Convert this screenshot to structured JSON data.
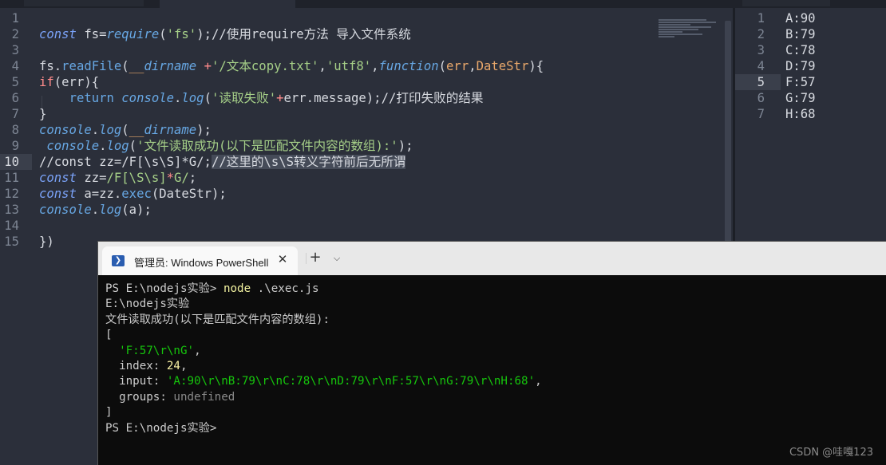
{
  "editor": {
    "lines": [
      {
        "n": "1",
        "segs": []
      },
      {
        "n": "2",
        "segs": [
          [
            "kw",
            "const"
          ],
          [
            "plain",
            " fs="
          ],
          [
            "it",
            "require"
          ],
          [
            "plain",
            "("
          ],
          [
            "str",
            "'fs'"
          ],
          [
            "plain",
            ");//使用require方法 导入文件系统"
          ]
        ]
      },
      {
        "n": "3",
        "segs": []
      },
      {
        "n": "4",
        "segs": [
          [
            "plain",
            "fs."
          ],
          [
            "fn",
            "readFile"
          ],
          [
            "plain",
            "("
          ],
          [
            "param",
            "__"
          ],
          [
            "it",
            "dirname"
          ],
          [
            "plain",
            " "
          ],
          [
            "op",
            "+"
          ],
          [
            "str",
            "'/文本copy.txt'"
          ],
          [
            "plain",
            ","
          ],
          [
            "str",
            "'utf8'"
          ],
          [
            "plain",
            ","
          ],
          [
            "it",
            "function"
          ],
          [
            "plain",
            "("
          ],
          [
            "param",
            "err"
          ],
          [
            "plain",
            ","
          ],
          [
            "param",
            "DateStr"
          ],
          [
            "plain",
            "){"
          ]
        ]
      },
      {
        "n": "5",
        "segs": [
          [
            "op",
            "if"
          ],
          [
            "plain",
            "(err){"
          ]
        ]
      },
      {
        "n": "6",
        "segs": [
          [
            "plain",
            "    "
          ],
          [
            "fn",
            "return"
          ],
          [
            "plain",
            " "
          ],
          [
            "it",
            "console"
          ],
          [
            "plain",
            "."
          ],
          [
            "it",
            "log"
          ],
          [
            "plain",
            "("
          ],
          [
            "str",
            "'读取失败'"
          ],
          [
            "op",
            "+"
          ],
          [
            "plain",
            "err.message);//打印失败的结果"
          ]
        ]
      },
      {
        "n": "7",
        "segs": [
          [
            "plain",
            "}"
          ]
        ]
      },
      {
        "n": "8",
        "segs": [
          [
            "it",
            "console"
          ],
          [
            "plain",
            "."
          ],
          [
            "it",
            "log"
          ],
          [
            "plain",
            "("
          ],
          [
            "param",
            "__"
          ],
          [
            "it",
            "dirname"
          ],
          [
            "plain",
            ");"
          ]
        ]
      },
      {
        "n": "9",
        "segs": [
          [
            "plain",
            " "
          ],
          [
            "it",
            "console"
          ],
          [
            "plain",
            "."
          ],
          [
            "it",
            "log"
          ],
          [
            "plain",
            "("
          ],
          [
            "str",
            "'文件读取成功(以下是匹配文件内容的数组):'"
          ],
          [
            "plain",
            ");"
          ]
        ]
      },
      {
        "n": "10",
        "current": true,
        "segs": [
          [
            "plain",
            "//const zz=/F[\\s\\S]*G/;"
          ],
          [
            "selplain",
            "//这里的\\s\\S转义字符前后无所谓"
          ]
        ]
      },
      {
        "n": "11",
        "segs": [
          [
            "kw",
            "const"
          ],
          [
            "plain",
            " zz="
          ],
          [
            "str",
            "/F[\\S\\s]"
          ],
          [
            "op",
            "*"
          ],
          [
            "str",
            "G/"
          ],
          [
            "plain",
            ";"
          ]
        ]
      },
      {
        "n": "12",
        "segs": [
          [
            "kw",
            "const"
          ],
          [
            "plain",
            " a="
          ],
          [
            "plain",
            "zz."
          ],
          [
            "fn",
            "exec"
          ],
          [
            "plain",
            "(DateStr);"
          ]
        ]
      },
      {
        "n": "13",
        "segs": [
          [
            "it",
            "console"
          ],
          [
            "plain",
            "."
          ],
          [
            "it",
            "log"
          ],
          [
            "plain",
            "(a);"
          ]
        ]
      },
      {
        "n": "14",
        "segs": []
      },
      {
        "n": "15",
        "segs": [
          [
            "plain",
            "})"
          ]
        ]
      }
    ]
  },
  "right_pane": {
    "lines": [
      {
        "n": "1",
        "text": "A:90"
      },
      {
        "n": "2",
        "text": "B:79"
      },
      {
        "n": "3",
        "text": "C:78"
      },
      {
        "n": "4",
        "text": "D:79"
      },
      {
        "n": "5",
        "text": "F:57",
        "current": true
      },
      {
        "n": "6",
        "text": "G:79"
      },
      {
        "n": "7",
        "text": "H:68"
      }
    ]
  },
  "terminal": {
    "tab_title": "管理员: Windows PowerShell",
    "close_glyph": "✕",
    "add_glyph": "+",
    "dropdown_glyph": "⌵",
    "icon_glyph": "❯",
    "lines": [
      [
        [
          "plain",
          "PS E:\\nodejs实验> "
        ],
        [
          "cmd",
          "node"
        ],
        [
          "plain",
          " .\\exec.js"
        ]
      ],
      [
        [
          "plain",
          "E:\\nodejs实验"
        ]
      ],
      [
        [
          "plain",
          "文件读取成功(以下是匹配文件内容的数组):"
        ]
      ],
      [
        [
          "plain",
          "["
        ]
      ],
      [
        [
          "plain",
          "  "
        ],
        [
          "green",
          "'F:57\\r\\nG'"
        ],
        [
          "plain",
          ","
        ]
      ],
      [
        [
          "plain",
          "  index: "
        ],
        [
          "yellow",
          "24"
        ],
        [
          "plain",
          ","
        ]
      ],
      [
        [
          "plain",
          "  input: "
        ],
        [
          "green",
          "'A:90\\r\\nB:79\\r\\nC:78\\r\\nD:79\\r\\nF:57\\r\\nG:79\\r\\nH:68'"
        ],
        [
          "plain",
          ","
        ]
      ],
      [
        [
          "plain",
          "  groups: "
        ],
        [
          "gray",
          "undefined"
        ]
      ],
      [
        [
          "plain",
          "]"
        ]
      ],
      [
        [
          "plain",
          "PS E:\\nodejs实验>"
        ]
      ]
    ]
  },
  "watermark": "CSDN @哇嘎123",
  "colors": {
    "editor_bg": "#2b2f3a",
    "terminal_bg": "#0c0c0c",
    "keyword": "#7aa2f7",
    "string": "#a6d088",
    "operator": "#ff8b8b",
    "param": "#e9a86b",
    "term_green": "#16c60c",
    "term_yellow": "#f9f1a5"
  }
}
